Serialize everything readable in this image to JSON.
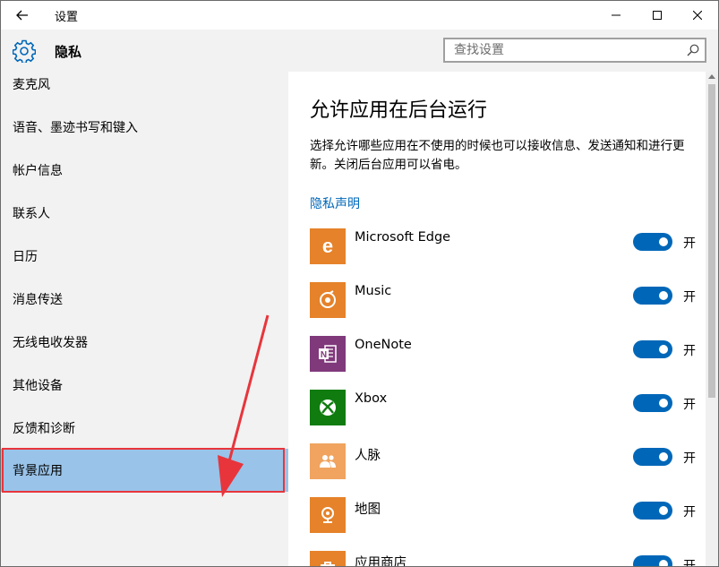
{
  "window": {
    "title": "设置"
  },
  "header": {
    "page_title": "隐私",
    "search_placeholder": "查找设置"
  },
  "sidebar": {
    "items": [
      {
        "label": "麦克风"
      },
      {
        "label": "语音、墨迹书写和键入"
      },
      {
        "label": "帐户信息"
      },
      {
        "label": "联系人"
      },
      {
        "label": "日历"
      },
      {
        "label": "消息传送"
      },
      {
        "label": "无线电收发器"
      },
      {
        "label": "其他设备"
      },
      {
        "label": "反馈和诊断"
      },
      {
        "label": "背景应用",
        "selected": true
      }
    ]
  },
  "main": {
    "heading": "允许应用在后台运行",
    "description": "选择允许哪些应用在不使用的时候也可以接收信息、发送通知和进行更新。关闭后台应用可以省电。",
    "privacy_link": "隐私声明",
    "apps": [
      {
        "name": "Microsoft Edge",
        "icon": "edge-icon",
        "icon_color": "#e5822a",
        "toggle_on": true,
        "toggle_label": "开"
      },
      {
        "name": "Music",
        "icon": "music-icon",
        "icon_color": "#e5822a",
        "toggle_on": true,
        "toggle_label": "开"
      },
      {
        "name": "OneNote",
        "icon": "onenote-icon",
        "icon_color": "#80397b",
        "toggle_on": true,
        "toggle_label": "开"
      },
      {
        "name": "Xbox",
        "icon": "xbox-icon",
        "icon_color": "#107c10",
        "toggle_on": true,
        "toggle_label": "开"
      },
      {
        "name": "人脉",
        "icon": "people-icon",
        "icon_color": "#f0a460",
        "toggle_on": true,
        "toggle_label": "开"
      },
      {
        "name": "地图",
        "icon": "maps-icon",
        "icon_color": "#e5822a",
        "toggle_on": true,
        "toggle_label": "开"
      },
      {
        "name": "应用商店",
        "icon": "store-icon",
        "icon_color": "#e5822a",
        "toggle_on": true,
        "toggle_label": "开"
      }
    ]
  },
  "colors": {
    "accent": "#0067b8",
    "sidebar_bg": "#f2f2f2",
    "selected_bg": "#99c3e8",
    "annotation_red": "#e8353c"
  }
}
